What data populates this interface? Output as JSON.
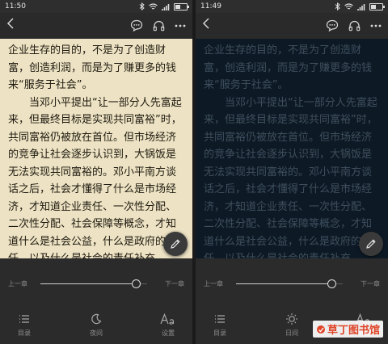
{
  "panels": [
    {
      "time": "11:50",
      "theme": "day",
      "paragraphs": [
        {
          "indent": false,
          "text": "企业生存的目的，不是为了创造财富，创造利润，而是为了赚更多的钱来“服务于社会”。"
        },
        {
          "indent": true,
          "text": "当邓小平提出“让一部分人先富起来，但最终目标是实现共同富裕”时，共同富裕仍被放在首位。但市场经济的竞争让社会逐步认识到，大锅饭是无法实现共同富裕的。邓小平南方谈话之后，社会才懂得了什么是市场经济，才知道企业责任、一次性分配、二次性分配、社会保障等概念，才知道什么是社会公益，什么是政府的责任，以及什么是社会的责任补充。"
        }
      ],
      "progress": {
        "prev": "上一章",
        "next": "下一章",
        "value": 0.9
      },
      "tabs": [
        {
          "icon": "menu-list-icon",
          "label": "目录"
        },
        {
          "icon": "moon-icon",
          "label": "夜间"
        },
        {
          "icon": "font-aa-icon",
          "label": "设置"
        }
      ]
    },
    {
      "time": "11:49",
      "theme": "night",
      "paragraphs": [
        {
          "indent": false,
          "text": "企业生存的目的，不是为了创造财富，创造利润，而是为了赚更多的钱来“服务于社会”。"
        },
        {
          "indent": true,
          "text": "当邓小平提出“让一部分人先富起来，但最终目标是实现共同富裕”时，共同富裕仍被放在首位。但市场经济的竞争让社会逐步认识到，大锅饭是无法实现共同富裕的。邓小平南方谈话之后，社会才懂得了什么是市场经济，才知道企业责任、一次性分配、二次性分配、社会保障等概念，才知道什么是社会公益，什么是政府的责任，以及什么是社会的责任补充。"
        }
      ],
      "progress": {
        "prev": "上一章",
        "next": "下一章",
        "value": 0.9
      },
      "tabs": [
        {
          "icon": "menu-list-icon",
          "label": "目录"
        },
        {
          "icon": "sun-icon",
          "label": "日间"
        },
        {
          "icon": "font-aa-icon",
          "label": "设置"
        }
      ]
    }
  ],
  "watermark": {
    "text": "草丁图书馆"
  },
  "colors": {
    "day_page": "#ede3c4",
    "night_page": "#0d1a26",
    "bars": "#2b2b2b",
    "watermark": "#e04428"
  }
}
